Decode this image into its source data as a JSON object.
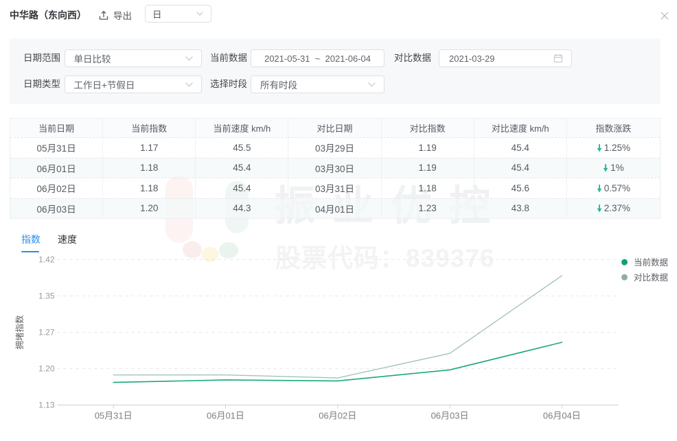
{
  "header": {
    "title": "中华路（东向西）",
    "export_label": "导出",
    "granularity_value": "日"
  },
  "filters": {
    "date_range": {
      "label": "日期范围",
      "value": "单日比较"
    },
    "current_data": {
      "label": "当前数据",
      "value": "2021-05-31  ~  2021-06-04"
    },
    "compare_data": {
      "label": "对比数据",
      "value": "2021-03-29"
    },
    "date_type": {
      "label": "日期类型",
      "value": "工作日+节假日"
    },
    "time_period": {
      "label": "选择时段",
      "value": "所有时段"
    }
  },
  "table": {
    "columns": [
      "当前日期",
      "当前指数",
      "当前速度 km/h",
      "对比日期",
      "对比指数",
      "对比速度 km/h",
      "指数涨跌"
    ],
    "down_arrow": "↓",
    "rows": [
      {
        "cells": [
          "05月31日",
          "1.17",
          "45.5",
          "03月29日",
          "1.19",
          "45.4"
        ],
        "change": "1.25%",
        "trend": "down"
      },
      {
        "cells": [
          "06月01日",
          "1.18",
          "45.4",
          "03月30日",
          "1.19",
          "45.4"
        ],
        "change": "1%",
        "trend": "down"
      },
      {
        "cells": [
          "06月02日",
          "1.18",
          "45.4",
          "03月31日",
          "1.18",
          "45.6"
        ],
        "change": "0.57%",
        "trend": "down"
      },
      {
        "cells": [
          "06月03日",
          "1.20",
          "44.3",
          "04月01日",
          "1.23",
          "43.8"
        ],
        "change": "2.37%",
        "trend": "down"
      }
    ]
  },
  "tabs": [
    {
      "label": "指数",
      "active": true
    },
    {
      "label": "速度",
      "active": false
    }
  ],
  "watermark": {
    "text": "振业优控",
    "subtext": "股票代码：839376"
  },
  "chart_data": {
    "type": "line",
    "x": [
      "05月31日",
      "06月01日",
      "06月02日",
      "06月03日",
      "06月04日"
    ],
    "series": [
      {
        "name": "当前数据",
        "values": [
          1.175,
          1.18,
          1.178,
          1.2,
          1.255
        ],
        "color": "#19a77f",
        "legend_color": "#12a077"
      },
      {
        "name": "对比数据",
        "values": [
          1.19,
          1.19,
          1.184,
          1.233,
          1.388
        ],
        "color": "#a3c4b6",
        "legend_color": "#8fafa3"
      }
    ],
    "ylabel": "拥堵指数",
    "ytick_labels": [
      "1.13",
      "1.20",
      "1.27",
      "1.35",
      "1.42"
    ],
    "ylim": [
      1.13,
      1.42
    ],
    "xlabel": "",
    "title": "",
    "grid": "dashed",
    "legend_position": "right"
  }
}
